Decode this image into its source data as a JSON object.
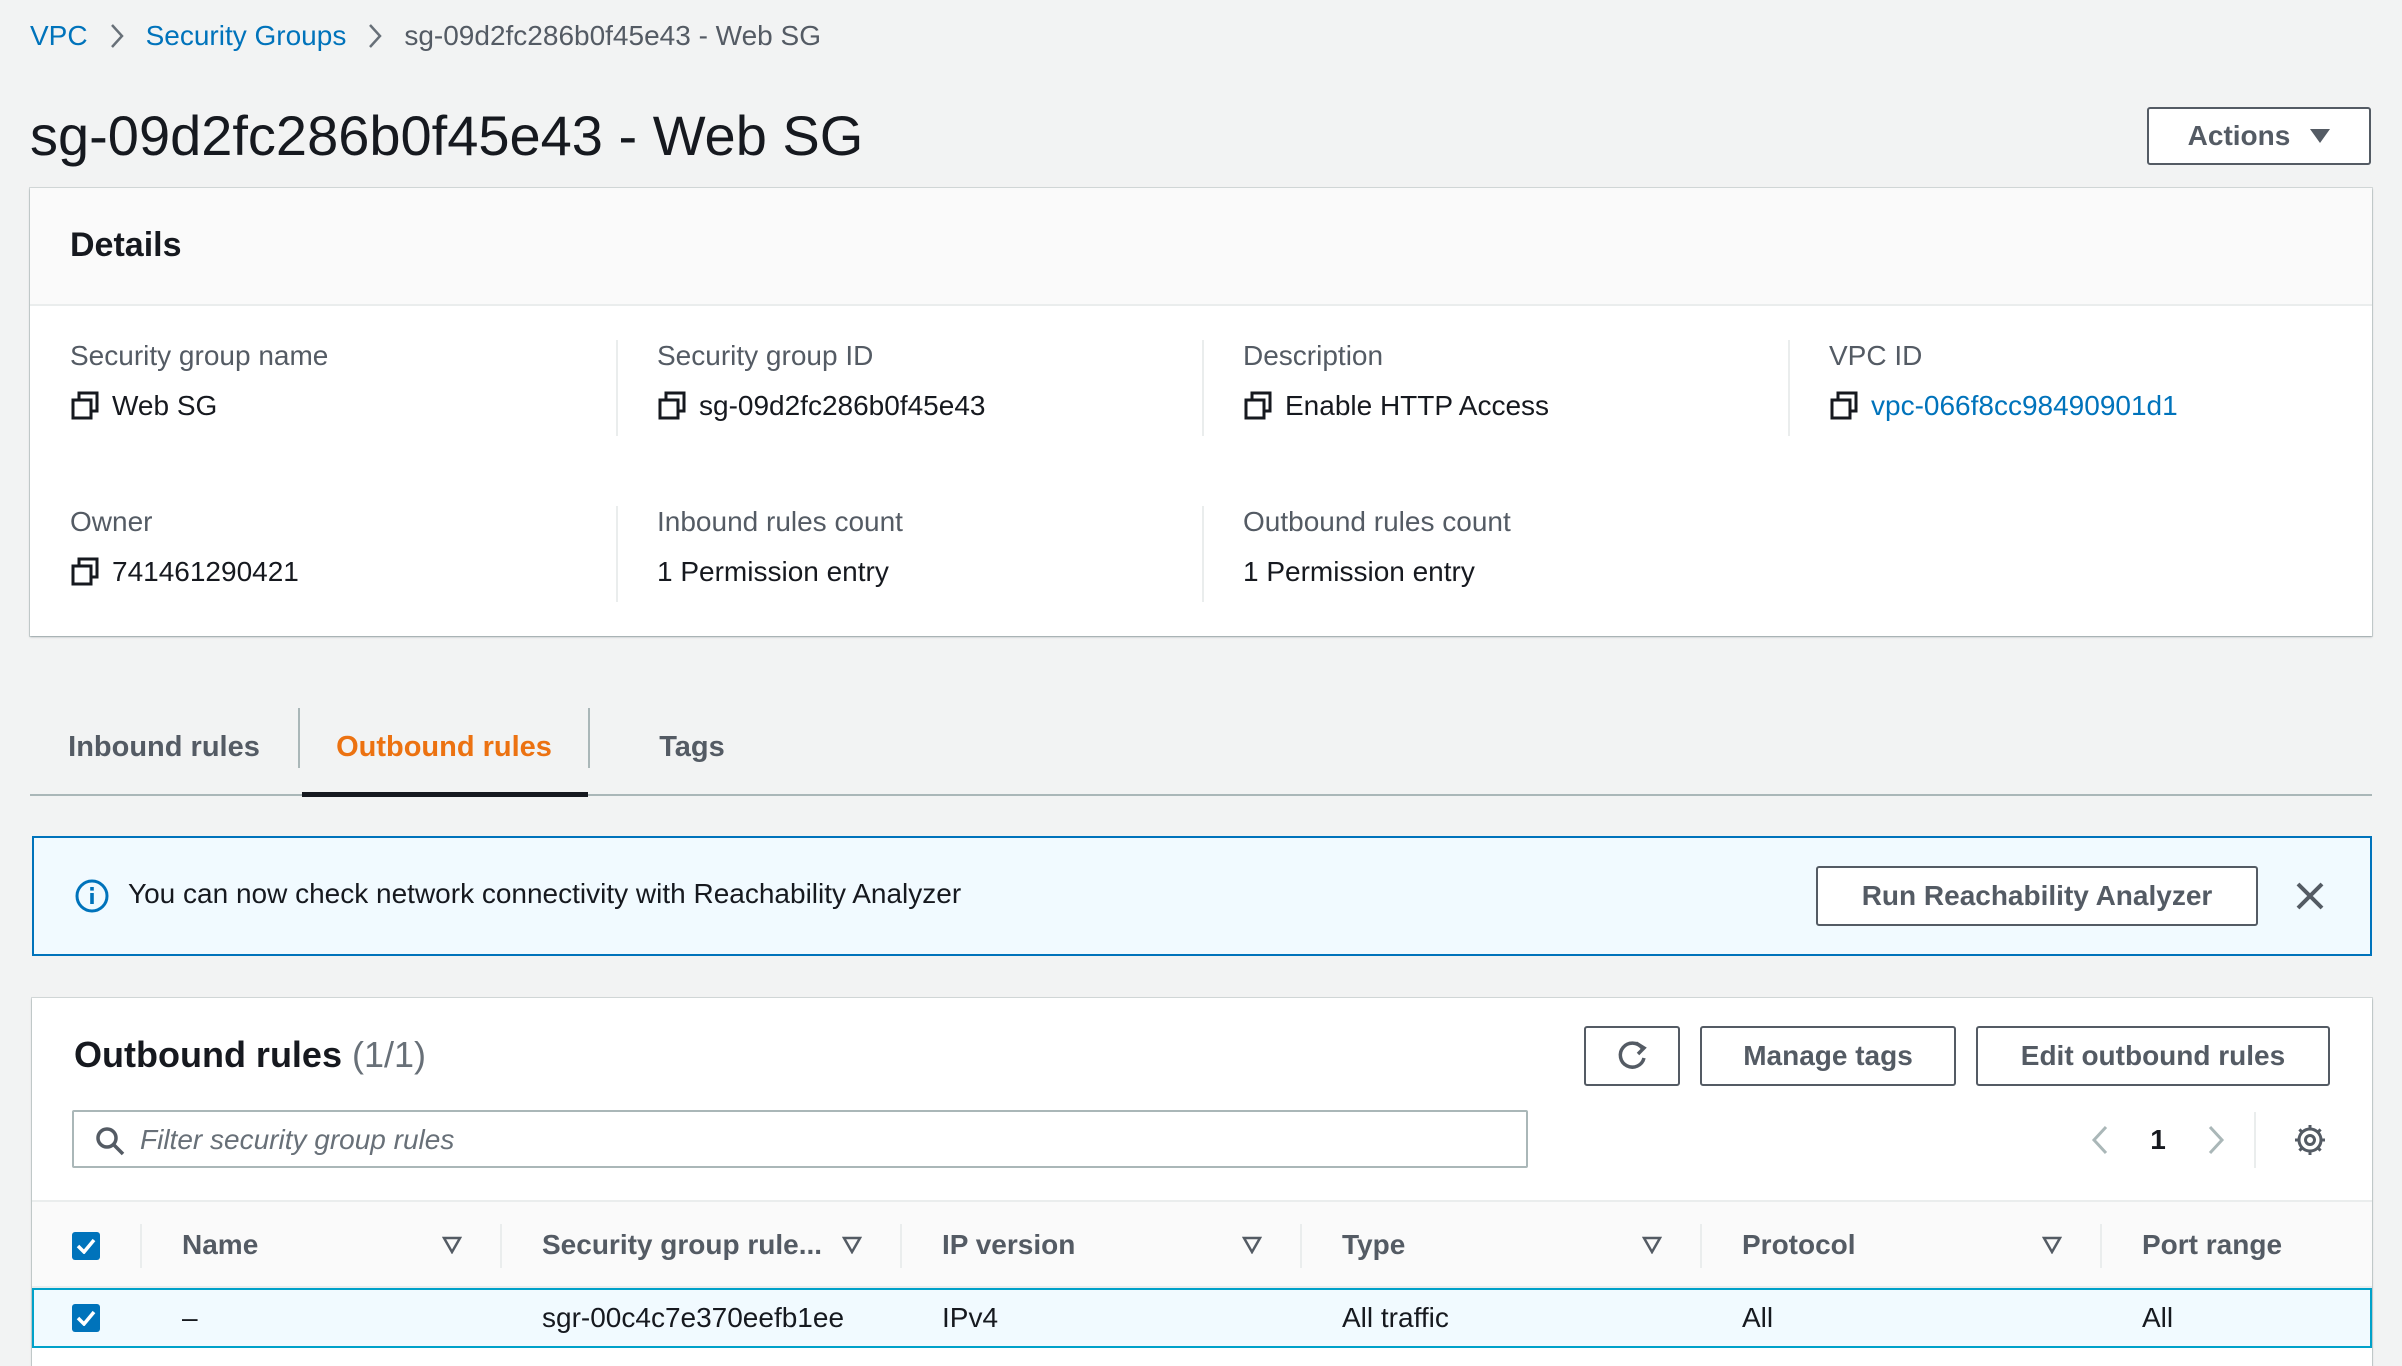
{
  "breadcrumb": {
    "items": [
      "VPC",
      "Security Groups",
      "sg-09d2fc286b0f45e43 - Web SG"
    ]
  },
  "page": {
    "title": "sg-09d2fc286b0f45e43 - Web SG",
    "actions_label": "Actions"
  },
  "details": {
    "title": "Details",
    "fields": {
      "sg_name": {
        "label": "Security group name",
        "value": "Web SG"
      },
      "sg_id": {
        "label": "Security group ID",
        "value": "sg-09d2fc286b0f45e43"
      },
      "description": {
        "label": "Description",
        "value": "Enable HTTP Access"
      },
      "vpc_id": {
        "label": "VPC ID",
        "value": "vpc-066f8cc98490901d1"
      },
      "owner": {
        "label": "Owner",
        "value": "741461290421"
      },
      "inbound_count": {
        "label": "Inbound rules count",
        "value": "1 Permission entry"
      },
      "outbound_count": {
        "label": "Outbound rules count",
        "value": "1 Permission entry"
      }
    }
  },
  "tabs": {
    "items": [
      "Inbound rules",
      "Outbound rules",
      "Tags"
    ],
    "active": "Outbound rules"
  },
  "alert": {
    "text": "You can now check network connectivity with Reachability Analyzer",
    "button_label": "Run Reachability Analyzer"
  },
  "rules_table": {
    "title": "Outbound rules",
    "count": "(1/1)",
    "manage_tags_label": "Manage tags",
    "edit_label": "Edit outbound rules",
    "search_placeholder": "Filter security group rules",
    "page_number": "1",
    "columns": [
      "Name",
      "Security group rule...",
      "IP version",
      "Type",
      "Protocol",
      "Port range"
    ],
    "rows": [
      {
        "name": "–",
        "rule_id": "sgr-00c4c7e370eefb1ee",
        "ip_version": "IPv4",
        "type": "All traffic",
        "protocol": "All",
        "port_range": "All"
      }
    ]
  },
  "colors": {
    "link": "#0073bb",
    "active_tab": "#ec7211",
    "text": "#16191f",
    "secondary_text": "#545b64",
    "alert_bg": "#f1faff"
  },
  "icons": [
    "chevron-right-icon",
    "caret-down-icon",
    "copy-icon",
    "info-icon",
    "close-icon",
    "refresh-icon",
    "search-icon",
    "chevron-left-icon",
    "gear-icon",
    "sort-icon",
    "checkbox-checked-icon"
  ]
}
